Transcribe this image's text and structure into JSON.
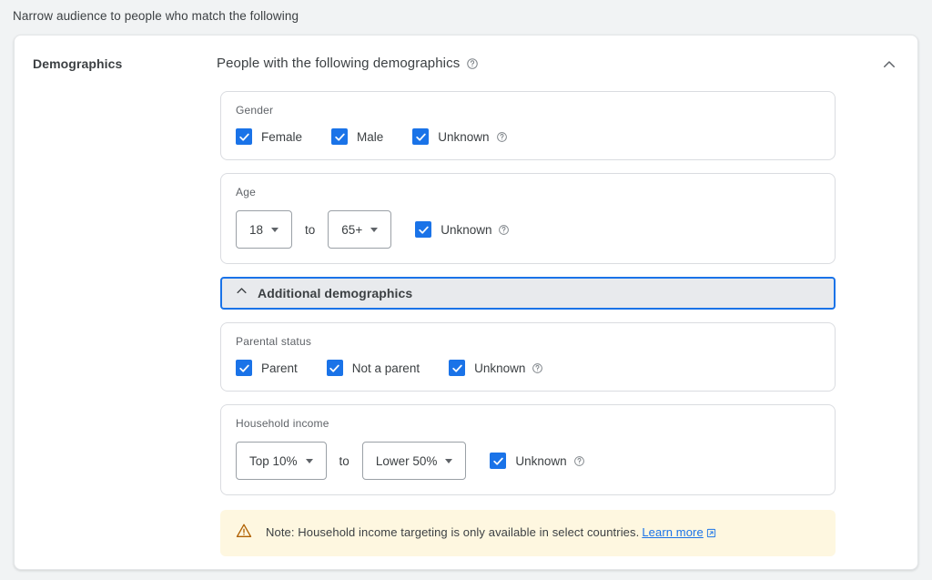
{
  "instruction": "Narrow audience to people who match the following",
  "card": {
    "left_label": "Demographics",
    "header_title": "People with the following demographics",
    "header_help_icon": "help-circle-icon",
    "collapse_icon": "chevron-up-icon"
  },
  "gender": {
    "label": "Gender",
    "options": [
      {
        "label": "Female",
        "checked": true,
        "help": false
      },
      {
        "label": "Male",
        "checked": true,
        "help": false
      },
      {
        "label": "Unknown",
        "checked": true,
        "help": true
      }
    ]
  },
  "age": {
    "label": "Age",
    "from_value": "18",
    "separator": "to",
    "to_value": "65+",
    "unknown": {
      "label": "Unknown",
      "checked": true,
      "help": true
    }
  },
  "additional_demographics": {
    "label": "Additional demographics",
    "icon": "chevron-up-icon",
    "expanded": true
  },
  "parental_status": {
    "label": "Parental status",
    "options": [
      {
        "label": "Parent",
        "checked": true,
        "help": false
      },
      {
        "label": "Not a parent",
        "checked": true,
        "help": false
      },
      {
        "label": "Unknown",
        "checked": true,
        "help": true
      }
    ]
  },
  "household_income": {
    "label": "Household income",
    "from_value": "Top 10%",
    "separator": "to",
    "to_value": "Lower 50%",
    "unknown": {
      "label": "Unknown",
      "checked": true,
      "help": true
    }
  },
  "note": {
    "icon": "warning-triangle-icon",
    "text": "Note: Household income targeting is only available in select countries.",
    "link_label": "Learn more",
    "link_icon": "external-link-icon"
  },
  "colors": {
    "accent": "#1a73e8",
    "page_bg": "#f1f3f4",
    "note_bg": "#fef7e0",
    "warning": "#b06000",
    "text": "#3c4043",
    "muted_text": "#5f6368",
    "border": "#dadce0"
  }
}
